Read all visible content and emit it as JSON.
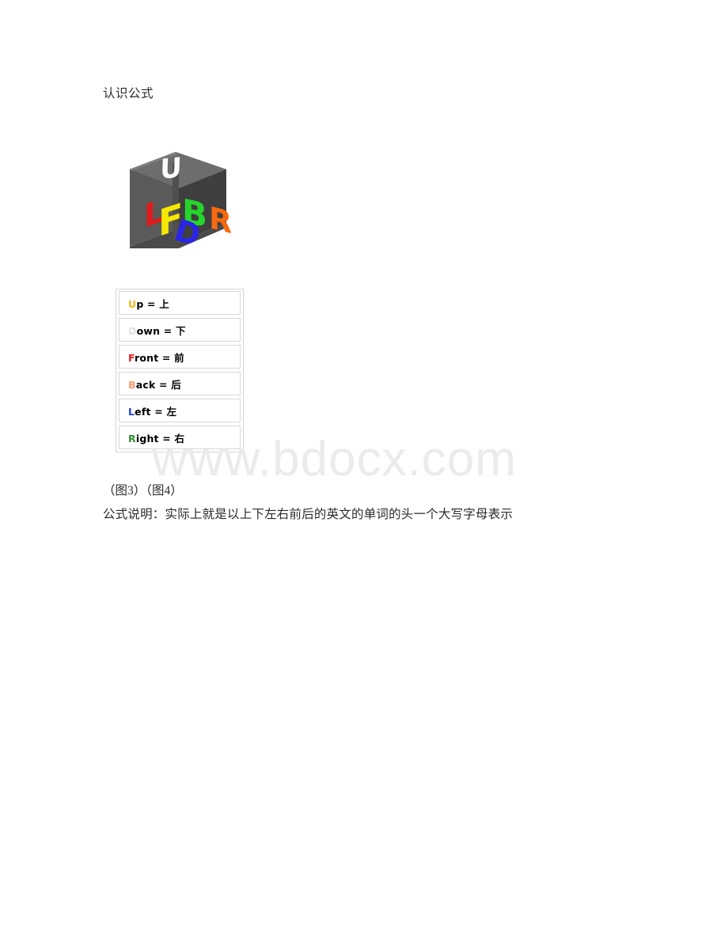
{
  "document": {
    "heading": "认识公式",
    "figure_caption": "（图3）（图4）",
    "explanation": "公式说明：实际上就是以上下左右前后的英文的单词的头一个大写字母表示",
    "watermark": "www.bdocx.com",
    "watermark_color": "#ebebeb",
    "background_color": "#ffffff",
    "text_color": "#2a2a2a"
  },
  "cube_figure": {
    "name": "rubiks-cube-notation-diagram",
    "body_color": "#565656",
    "top_face_color": "#6b6b6b",
    "right_face_color": "#3f3f3f",
    "bottom_edge_color": "#4a4a4a",
    "letters": [
      {
        "char": "U",
        "face": "up",
        "color": "#fdfdfd"
      },
      {
        "char": "L",
        "face": "left",
        "color": "#e01b1b"
      },
      {
        "char": "F",
        "face": "front",
        "color": "#f5e800"
      },
      {
        "char": "B",
        "face": "back",
        "color": "#25d52b"
      },
      {
        "char": "R",
        "face": "right",
        "color": "#f76a12"
      },
      {
        "char": "D",
        "face": "down",
        "color": "#2a24e8"
      }
    ]
  },
  "legend": {
    "name": "cube-face-notation-legend",
    "border_color": "#d4d4d4",
    "row_border_color": "#d8d8d8",
    "rows": [
      {
        "initial": "U",
        "rest": "p = ",
        "chinese": "上",
        "initial_color": "#f5b40a"
      },
      {
        "initial": "D",
        "rest": "own = ",
        "chinese": "下",
        "initial_color": "#e2e2e2"
      },
      {
        "initial": "F",
        "rest": "ront = ",
        "chinese": "前",
        "initial_color": "#ef1b1b"
      },
      {
        "initial": "B",
        "rest": "ack = ",
        "chinese": "后",
        "initial_color": "#fb9a6e"
      },
      {
        "initial": "L",
        "rest": "eft = ",
        "chinese": "左",
        "initial_color": "#1a3fe0"
      },
      {
        "initial": "R",
        "rest": "ight = ",
        "chinese": "右",
        "initial_color": "#2f8c34"
      }
    ]
  }
}
